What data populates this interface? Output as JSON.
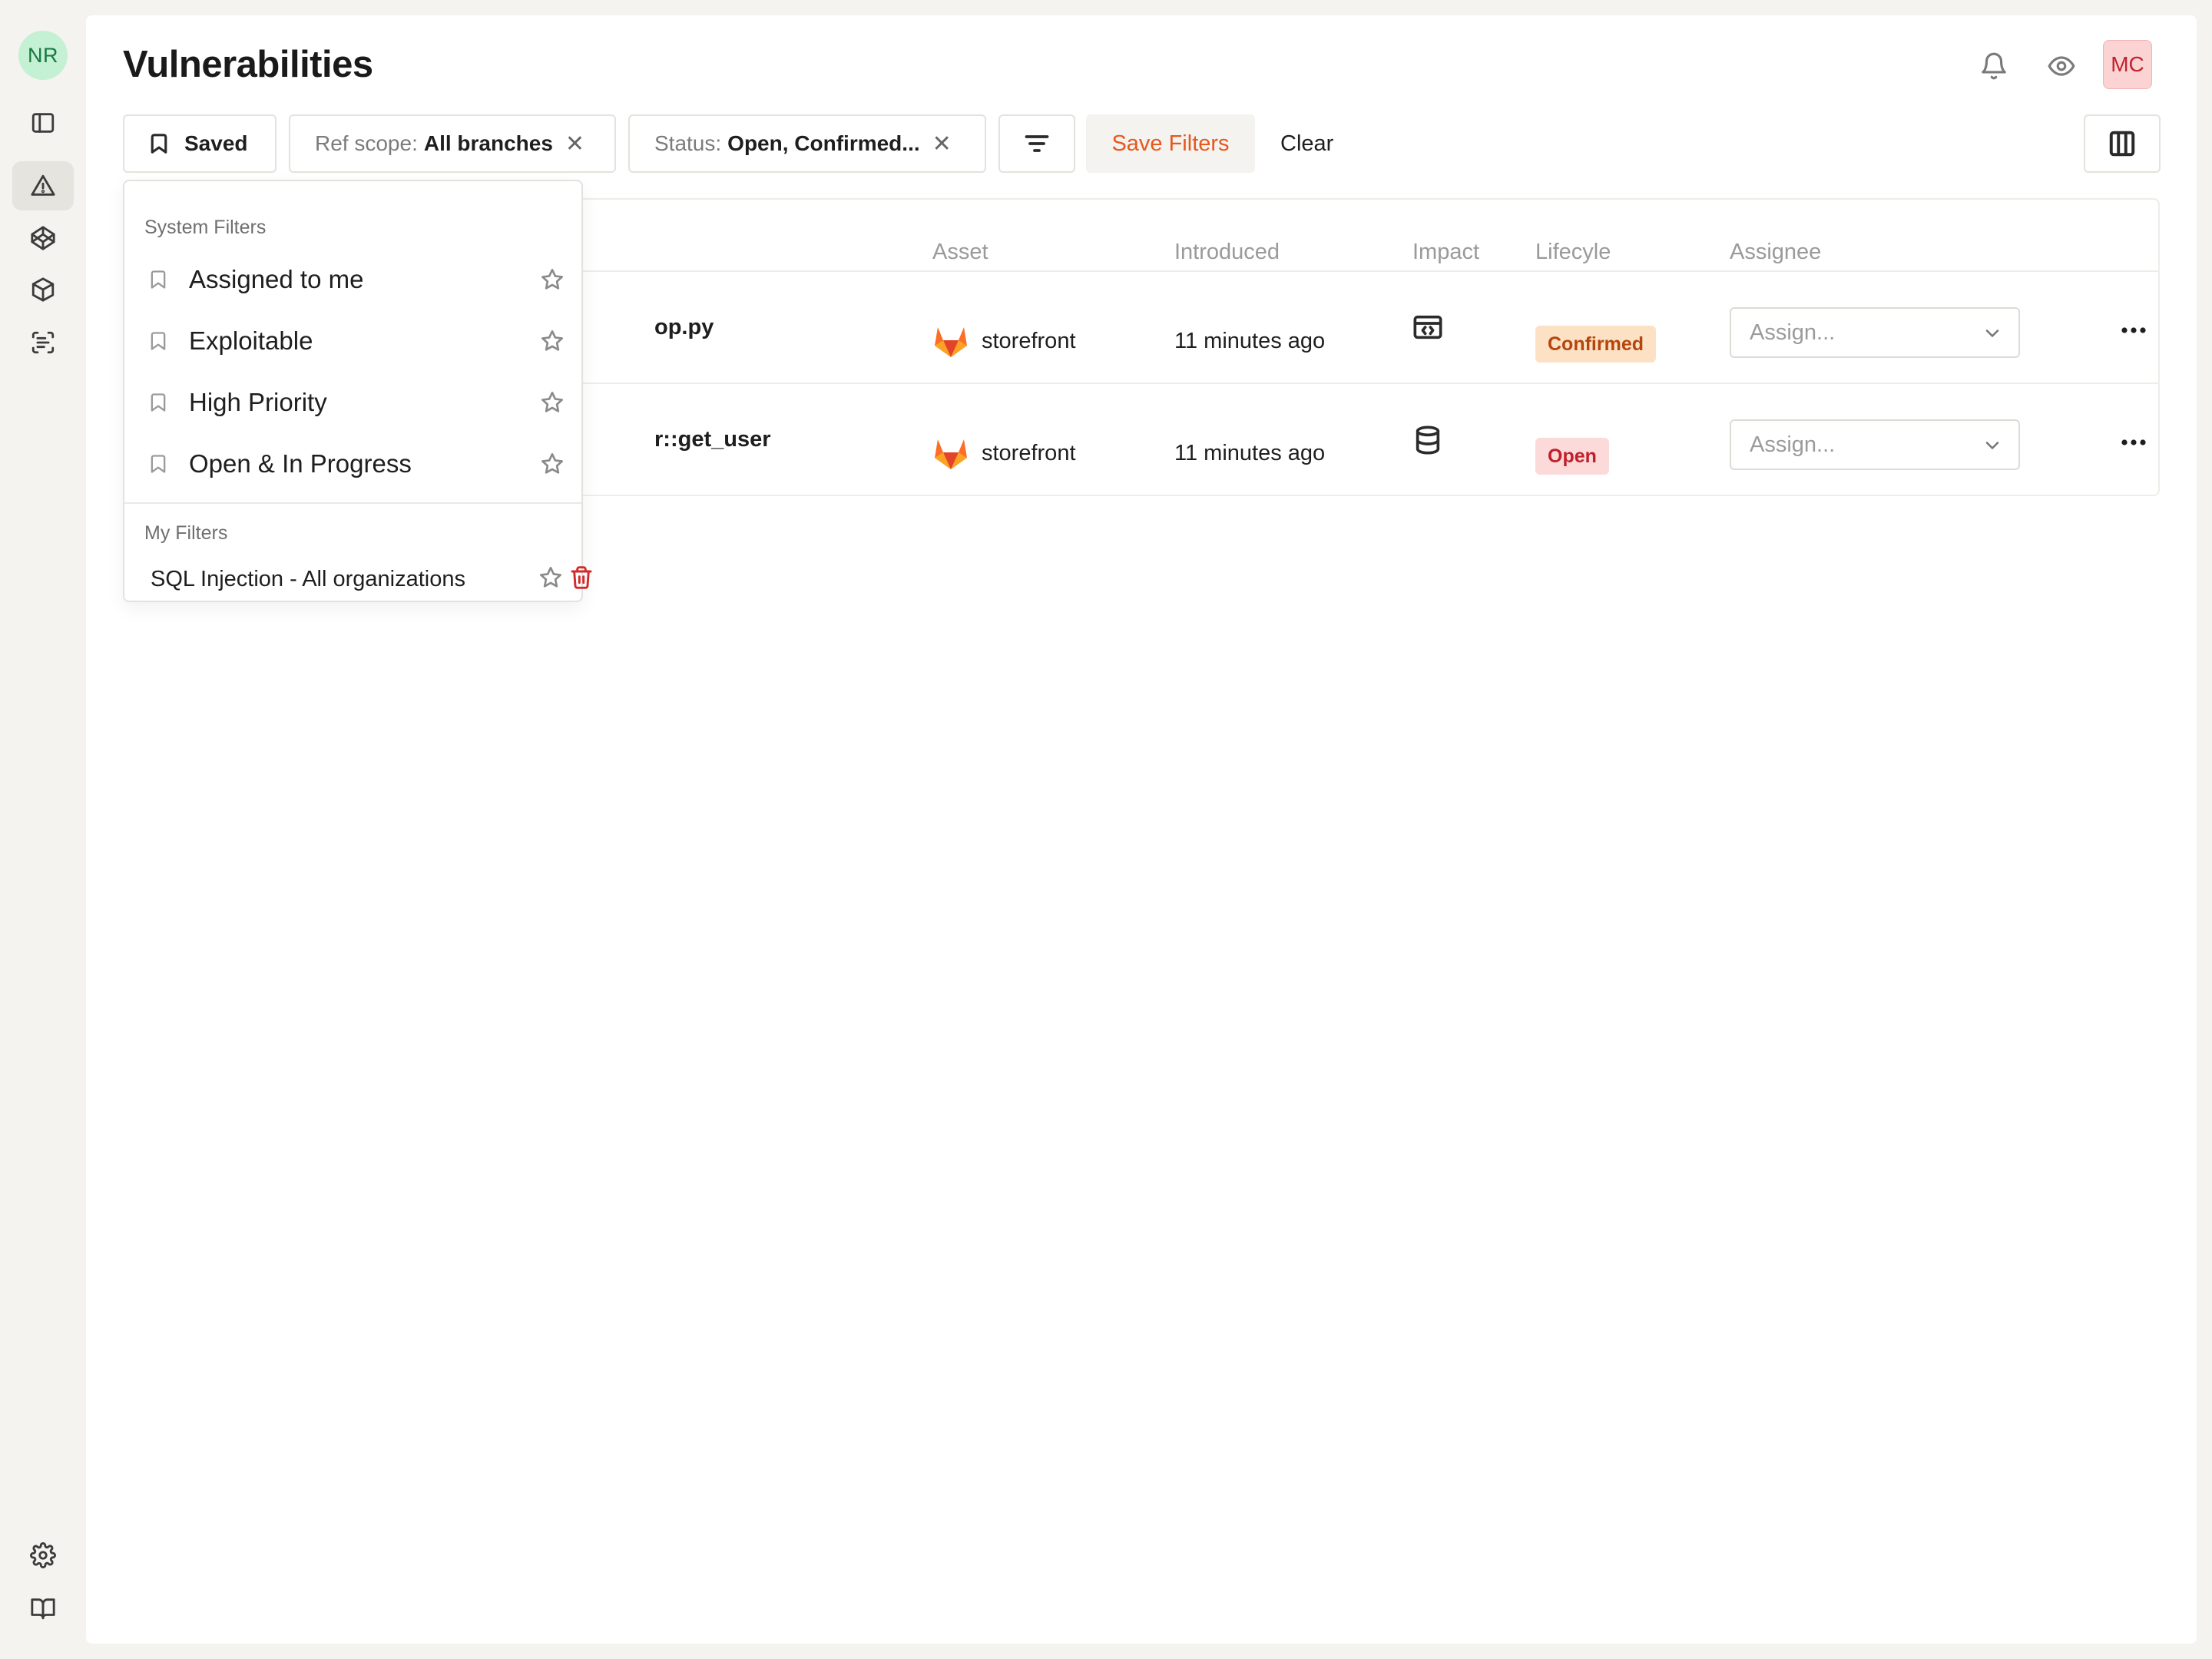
{
  "rail": {
    "workspace_initials": "NR",
    "nav_icons": [
      "sidebar-toggle-icon",
      "alert-triangle-icon",
      "codepen-icon",
      "package-icon",
      "scan-text-icon"
    ],
    "bottom_icons": [
      "settings-icon",
      "book-open-icon"
    ]
  },
  "header": {
    "title": "Vulnerabilities",
    "user_initials": "MC"
  },
  "filters": {
    "saved_label": "Saved",
    "ref_scope_label": "Ref scope:",
    "ref_scope_value": "All branches",
    "status_label": "Status:",
    "status_value": "Open, Confirmed...",
    "remove_glyph": "✕",
    "save_filters_label": "Save Filters",
    "clear_label": "Clear"
  },
  "table": {
    "columns": {
      "asset": "Asset",
      "introduced": "Introduced",
      "impact": "Impact",
      "lifecycle": "Lifecyle",
      "assignee": "Assignee"
    },
    "rows": [
      {
        "title_fragment": "op.py",
        "asset": "storefront",
        "introduced": "11 minutes ago",
        "impact_icon": "app-window-code-icon",
        "lifecycle": "Confirmed",
        "assignee_placeholder": "Assign..."
      },
      {
        "title_fragment": "r::get_user",
        "asset": "storefront",
        "introduced": "11 minutes ago",
        "impact_icon": "database-icon",
        "lifecycle": "Open",
        "assignee_placeholder": "Assign..."
      }
    ]
  },
  "dropdown": {
    "system_section": "System Filters",
    "system_items": [
      "Assigned to me",
      "Exploitable",
      "High Priority",
      "Open & In Progress"
    ],
    "my_section": "My Filters",
    "my_items": [
      "SQL Injection - All organizations"
    ]
  },
  "colors": {
    "accent_orange": "#e8571e",
    "confirmed_bg": "#fde1c4",
    "confirmed_text": "#b4460d",
    "open_bg": "#fcdada",
    "open_text": "#c0202a",
    "delete_red": "#d22b2b"
  }
}
